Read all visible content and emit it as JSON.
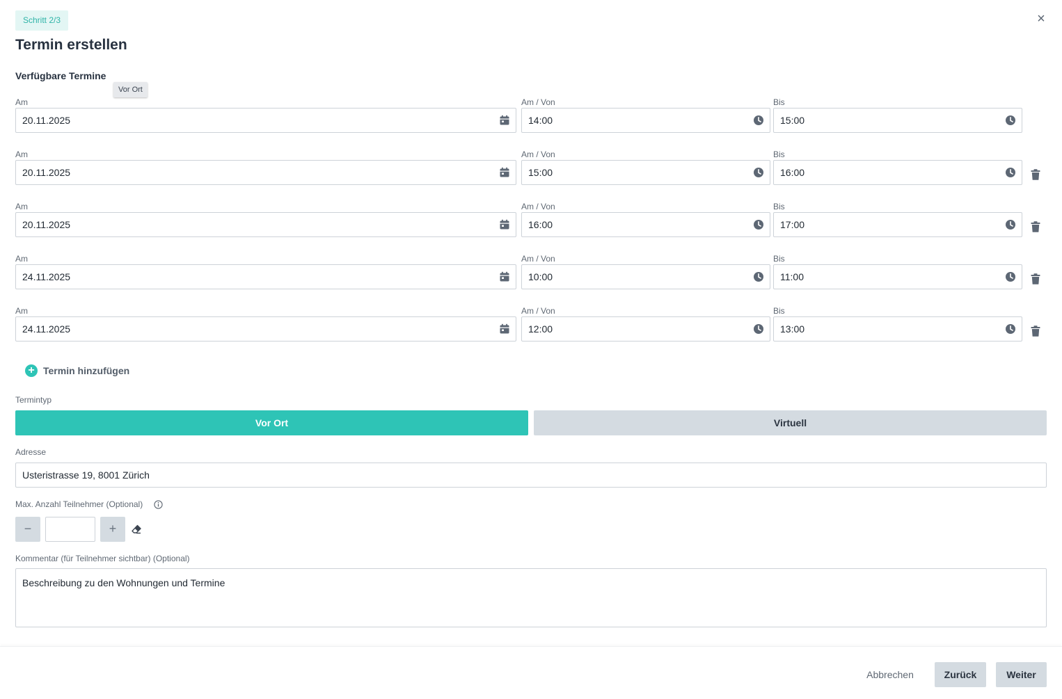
{
  "header": {
    "step": "Schritt 2/3",
    "title": "Termin erstellen",
    "close": "×"
  },
  "slots_section": {
    "title": "Verfügbare Termine",
    "tooltip": "Vor Ort",
    "date_label": "Am",
    "from_label": "Am / Von",
    "to_label": "Bis",
    "rows": [
      {
        "date": "20.11.2025",
        "from": "14:00",
        "to": "15:00",
        "deletable": false
      },
      {
        "date": "20.11.2025",
        "from": "15:00",
        "to": "16:00",
        "deletable": true
      },
      {
        "date": "20.11.2025",
        "from": "16:00",
        "to": "17:00",
        "deletable": true
      },
      {
        "date": "24.11.2025",
        "from": "10:00",
        "to": "11:00",
        "deletable": true
      },
      {
        "date": "24.11.2025",
        "from": "12:00",
        "to": "13:00",
        "deletable": true
      }
    ],
    "add_label": "Termin hinzufügen",
    "add_icon": "+"
  },
  "type_section": {
    "label": "Termintyp",
    "options": [
      "Vor Ort",
      "Virtuell"
    ],
    "selected": "Vor Ort"
  },
  "address": {
    "label": "Adresse",
    "value": "Usteristrasse 19, 8001 Zürich"
  },
  "participants": {
    "label": "Max. Anzahl Teilnehmer (Optional)",
    "value": "",
    "minus": "−",
    "plus": "+"
  },
  "comment": {
    "label": "Kommentar (für Teilnehmer sichtbar) (Optional)",
    "value": "Beschreibung zu den Wohnungen und Termine"
  },
  "footer": {
    "cancel": "Abbrechen",
    "back": "Zurück",
    "next": "Weiter"
  },
  "colors": {
    "accent": "#2ec4b6",
    "secondary_button": "#d4dbe1",
    "badge_bg": "#e3f6f4"
  }
}
